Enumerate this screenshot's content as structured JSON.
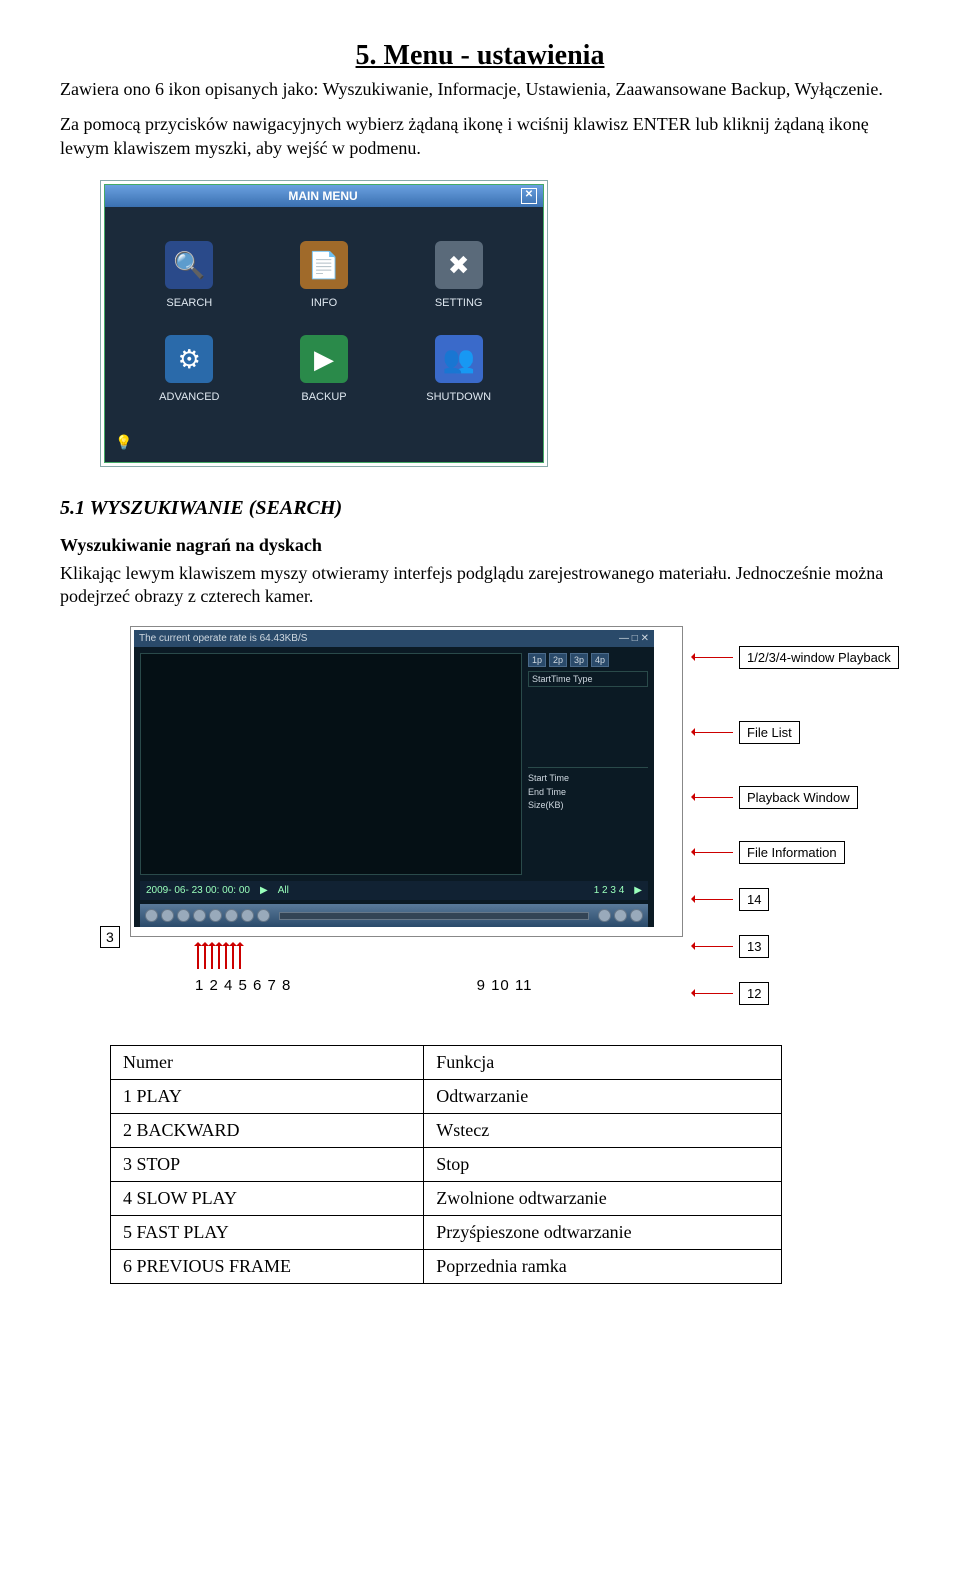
{
  "title": "5. Menu - ustawienia",
  "intro1": "Zawiera ono 6 ikon opisanych jako: Wyszukiwanie, Informacje, Ustawienia, Zaawansowane Backup, Wyłączenie.",
  "intro2": "Za pomocą przycisków nawigacyjnych wybierz żądaną ikonę i wciśnij klawisz ENTER lub kliknij żądaną ikonę lewym klawiszem myszki, aby wejść w podmenu.",
  "mainmenu": {
    "title": "MAIN MENU",
    "close": "✕",
    "items": [
      {
        "label": "SEARCH",
        "glyph": "🔍"
      },
      {
        "label": "INFO",
        "glyph": "📄"
      },
      {
        "label": "SETTING",
        "glyph": "✖"
      },
      {
        "label": "ADVANCED",
        "glyph": "⚙"
      },
      {
        "label": "BACKUP",
        "glyph": "▶"
      },
      {
        "label": "SHUTDOWN",
        "glyph": "👥"
      }
    ],
    "bulb": "💡"
  },
  "section51": "5.1 WYSZUKIWANIE (SEARCH)",
  "sub51h": "Wyszukiwanie nagrań na dyskach",
  "sub51a": "Klikając lewym klawiszem myszy otwieramy interfejs podglądu zarejestrowanego materiału. Jednocześnie można podejrzeć obrazy z czterech kamer.",
  "playback": {
    "bar_left": "The current operate rate is  64.43KB/S",
    "bar_right": "— □ ✕",
    "split_btns": [
      "1p",
      "2p",
      "3p",
      "4p"
    ],
    "start_lbl": "StartTime Type",
    "info_labels": [
      "Start Time",
      "End Time",
      "Size(KB)"
    ],
    "time_stamp": "2009- 06- 23  00: 00: 00",
    "time_all": "All",
    "time_chan": "1   2   3   4",
    "left_num": "3",
    "callouts": [
      "1/2/3/4-window Playback",
      "File List",
      "Playback Window",
      "File Information",
      "14",
      "13",
      "12"
    ],
    "bottom_nums_left": "1 2 4 5 6 7 8",
    "bottom_nums_right": "9 10 11"
  },
  "table": {
    "head": [
      "Numer",
      "Funkcja"
    ],
    "rows": [
      [
        "1  PLAY",
        "Odtwarzanie"
      ],
      [
        "2  BACKWARD",
        "Wstecz"
      ],
      [
        "3  STOP",
        "Stop"
      ],
      [
        "4  SLOW PLAY",
        "Zwolnione odtwarzanie"
      ],
      [
        "5  FAST PLAY",
        "Przyśpieszone odtwarzanie"
      ],
      [
        "6  PREVIOUS FRAME",
        "Poprzednia ramka"
      ]
    ]
  }
}
